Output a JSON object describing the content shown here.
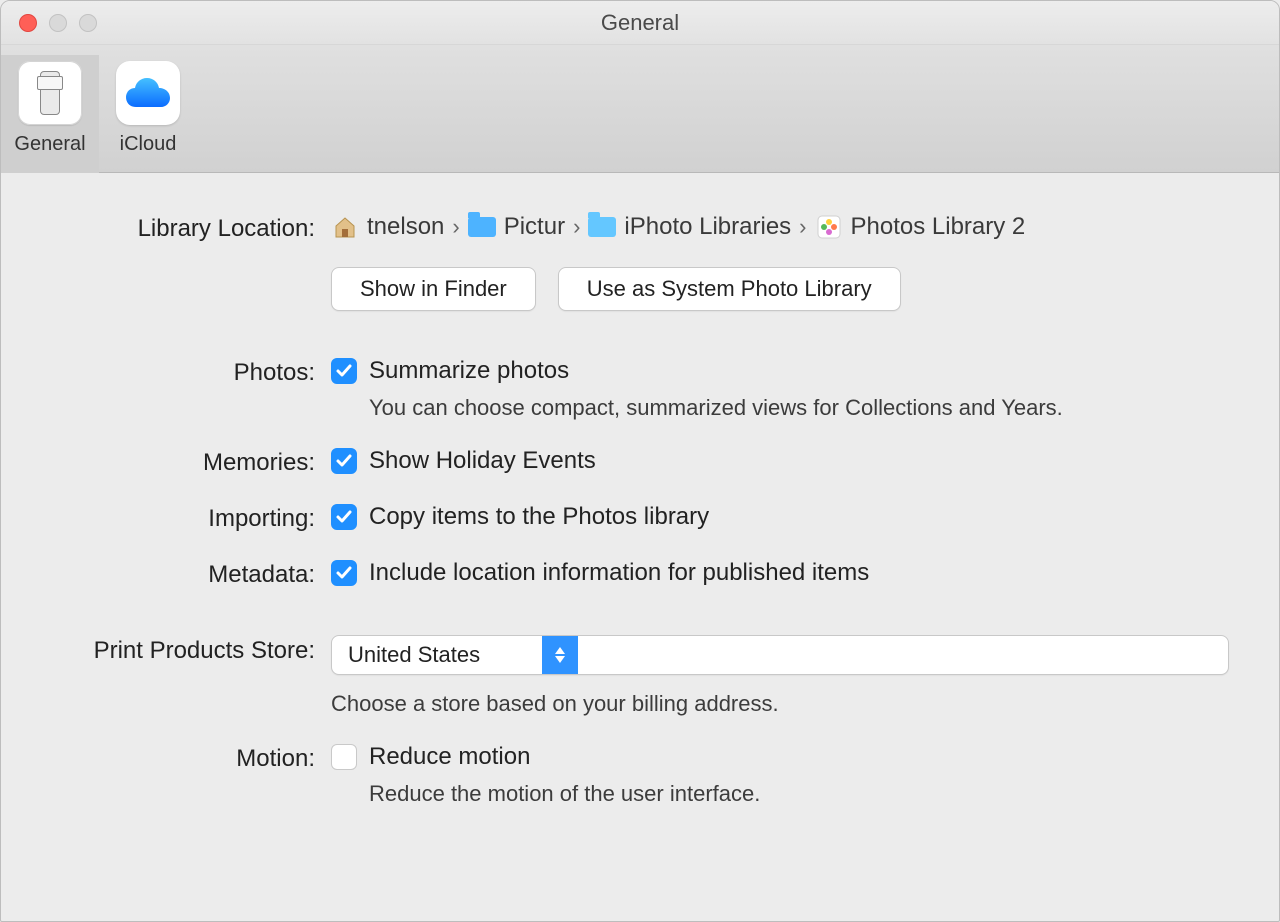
{
  "window": {
    "title": "General"
  },
  "tabs": [
    {
      "id": "general",
      "label": "General",
      "selected": true
    },
    {
      "id": "icloud",
      "label": "iCloud",
      "selected": false
    }
  ],
  "library_location": {
    "label": "Library Location:",
    "breadcrumb": [
      {
        "icon": "home",
        "text": "tnelson"
      },
      {
        "icon": "folder-blue",
        "text": "Pictur"
      },
      {
        "icon": "folder-light",
        "text": "iPhoto Libraries"
      },
      {
        "icon": "photos-app",
        "text": "Photos Library 2"
      }
    ],
    "buttons": {
      "show_in_finder": "Show in Finder",
      "use_as_system": "Use as System Photo Library"
    }
  },
  "photos": {
    "label": "Photos:",
    "checkbox_label": "Summarize photos",
    "checked": true,
    "subtext": "You can choose compact, summarized views for Collections and Years."
  },
  "memories": {
    "label": "Memories:",
    "checkbox_label": "Show Holiday Events",
    "checked": true
  },
  "importing": {
    "label": "Importing:",
    "checkbox_label": "Copy items to the Photos library",
    "checked": true
  },
  "metadata": {
    "label": "Metadata:",
    "checkbox_label": "Include location information for published items",
    "checked": true
  },
  "print_store": {
    "label": "Print Products Store:",
    "selected": "United States",
    "subtext": "Choose a store based on your billing address."
  },
  "motion": {
    "label": "Motion:",
    "checkbox_label": "Reduce motion",
    "checked": false,
    "subtext": "Reduce the motion of the user interface."
  }
}
